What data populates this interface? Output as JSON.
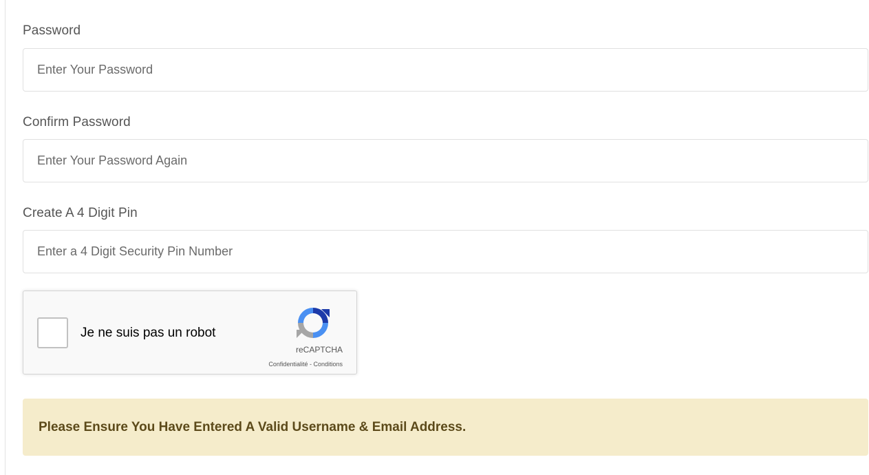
{
  "form": {
    "password": {
      "label": "Password",
      "placeholder": "Enter Your Password"
    },
    "confirm_password": {
      "label": "Confirm Password",
      "placeholder": "Enter Your Password Again"
    },
    "pin": {
      "label": "Create A 4 Digit Pin",
      "placeholder": "Enter a 4 Digit Security Pin Number"
    }
  },
  "captcha": {
    "label": "Je ne suis pas un robot",
    "brand": "reCAPTCHA",
    "privacy_link": "Confidentialité",
    "separator": " - ",
    "terms_link": "Conditions",
    "checked": false,
    "icon": "recaptcha-logo-icon"
  },
  "alert": {
    "message": "Please Ensure You Have Entered A Valid Username & Email Address.",
    "background_color": "#f5eccb",
    "text_color": "#5c4a1a"
  }
}
